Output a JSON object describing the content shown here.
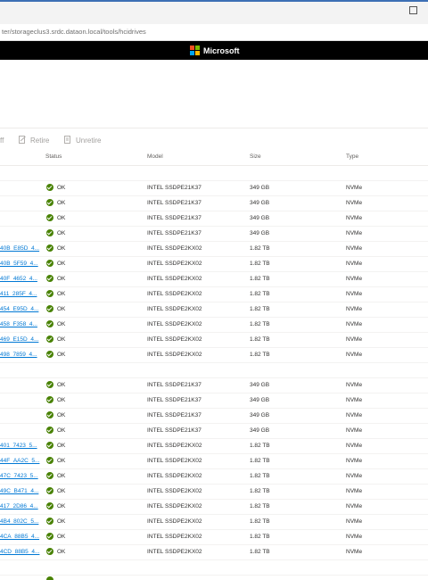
{
  "browser": {
    "url": "ter/storageclus3.srdc.dataon.local/tools/hcidrives"
  },
  "brand": {
    "name": "Microsoft",
    "logo_colors": [
      "#f25022",
      "#7fba00",
      "#00a4ef",
      "#ffb900"
    ]
  },
  "commands": {
    "partial": "ff",
    "retire": "Retire",
    "unretire": "Unretire"
  },
  "columns": {
    "status": "Status",
    "model": "Model",
    "size": "Size",
    "type": "Type"
  },
  "colors": {
    "ok": "#498205",
    "link": "#0078d4"
  },
  "rows": [
    {
      "name": "",
      "status": "OK",
      "model": "INTEL SSDPE21K37",
      "size": "349 GB",
      "type": "NVMe"
    },
    {
      "name": "",
      "status": "OK",
      "model": "INTEL SSDPE21K37",
      "size": "349 GB",
      "type": "NVMe"
    },
    {
      "name": "",
      "status": "OK",
      "model": "INTEL SSDPE21K37",
      "size": "349 GB",
      "type": "NVMe"
    },
    {
      "name": "",
      "status": "OK",
      "model": "INTEL SSDPE21K37",
      "size": "349 GB",
      "type": "NVMe"
    },
    {
      "name": "40B_E85D_4...",
      "status": "OK",
      "model": "INTEL SSDPE2KX02",
      "size": "1.82 TB",
      "type": "NVMe"
    },
    {
      "name": "40B_5F59_4...",
      "status": "OK",
      "model": "INTEL SSDPE2KX02",
      "size": "1.82 TB",
      "type": "NVMe"
    },
    {
      "name": "40F_4652_4...",
      "status": "OK",
      "model": "INTEL SSDPE2KX02",
      "size": "1.82 TB",
      "type": "NVMe"
    },
    {
      "name": "411_285F_4...",
      "status": "OK",
      "model": "INTEL SSDPE2KX02",
      "size": "1.82 TB",
      "type": "NVMe"
    },
    {
      "name": "454_E95D_4...",
      "status": "OK",
      "model": "INTEL SSDPE2KX02",
      "size": "1.82 TB",
      "type": "NVMe"
    },
    {
      "name": "458_F358_4...",
      "status": "OK",
      "model": "INTEL SSDPE2KX02",
      "size": "1.82 TB",
      "type": "NVMe"
    },
    {
      "name": "469_E15D_4...",
      "status": "OK",
      "model": "INTEL SSDPE2KX02",
      "size": "1.82 TB",
      "type": "NVMe"
    },
    {
      "name": "498_7859_4...",
      "status": "OK",
      "model": "INTEL SSDPE2KX02",
      "size": "1.82 TB",
      "type": "NVMe"
    },
    {
      "name": "",
      "status": "OK",
      "model": "INTEL SSDPE21K37",
      "size": "349 GB",
      "type": "NVMe"
    },
    {
      "name": "",
      "status": "OK",
      "model": "INTEL SSDPE21K37",
      "size": "349 GB",
      "type": "NVMe"
    },
    {
      "name": "",
      "status": "OK",
      "model": "INTEL SSDPE21K37",
      "size": "349 GB",
      "type": "NVMe"
    },
    {
      "name": "",
      "status": "OK",
      "model": "INTEL SSDPE21K37",
      "size": "349 GB",
      "type": "NVMe"
    },
    {
      "name": "401_7423_5...",
      "status": "OK",
      "model": "INTEL SSDPE2KX02",
      "size": "1.82 TB",
      "type": "NVMe"
    },
    {
      "name": "44F_AA2C_5...",
      "status": "OK",
      "model": "INTEL SSDPE2KX02",
      "size": "1.82 TB",
      "type": "NVMe"
    },
    {
      "name": "47C_7423_5...",
      "status": "OK",
      "model": "INTEL SSDPE2KX02",
      "size": "1.82 TB",
      "type": "NVMe"
    },
    {
      "name": "49C_B471_4...",
      "status": "OK",
      "model": "INTEL SSDPE2KX02",
      "size": "1.82 TB",
      "type": "NVMe"
    },
    {
      "name": "417_2D86_4...",
      "status": "OK",
      "model": "INTEL SSDPE2KX02",
      "size": "1.82 TB",
      "type": "NVMe"
    },
    {
      "name": "4B4_802C_5...",
      "status": "OK",
      "model": "INTEL SSDPE2KX02",
      "size": "1.82 TB",
      "type": "NVMe"
    },
    {
      "name": "4CA_88B5_4...",
      "status": "OK",
      "model": "INTEL SSDPE2KX02",
      "size": "1.82 TB",
      "type": "NVMe"
    },
    {
      "name": "4CD_88B5_4...",
      "status": "OK",
      "model": "INTEL SSDPE2KX02",
      "size": "1.82 TB",
      "type": "NVMe"
    }
  ]
}
